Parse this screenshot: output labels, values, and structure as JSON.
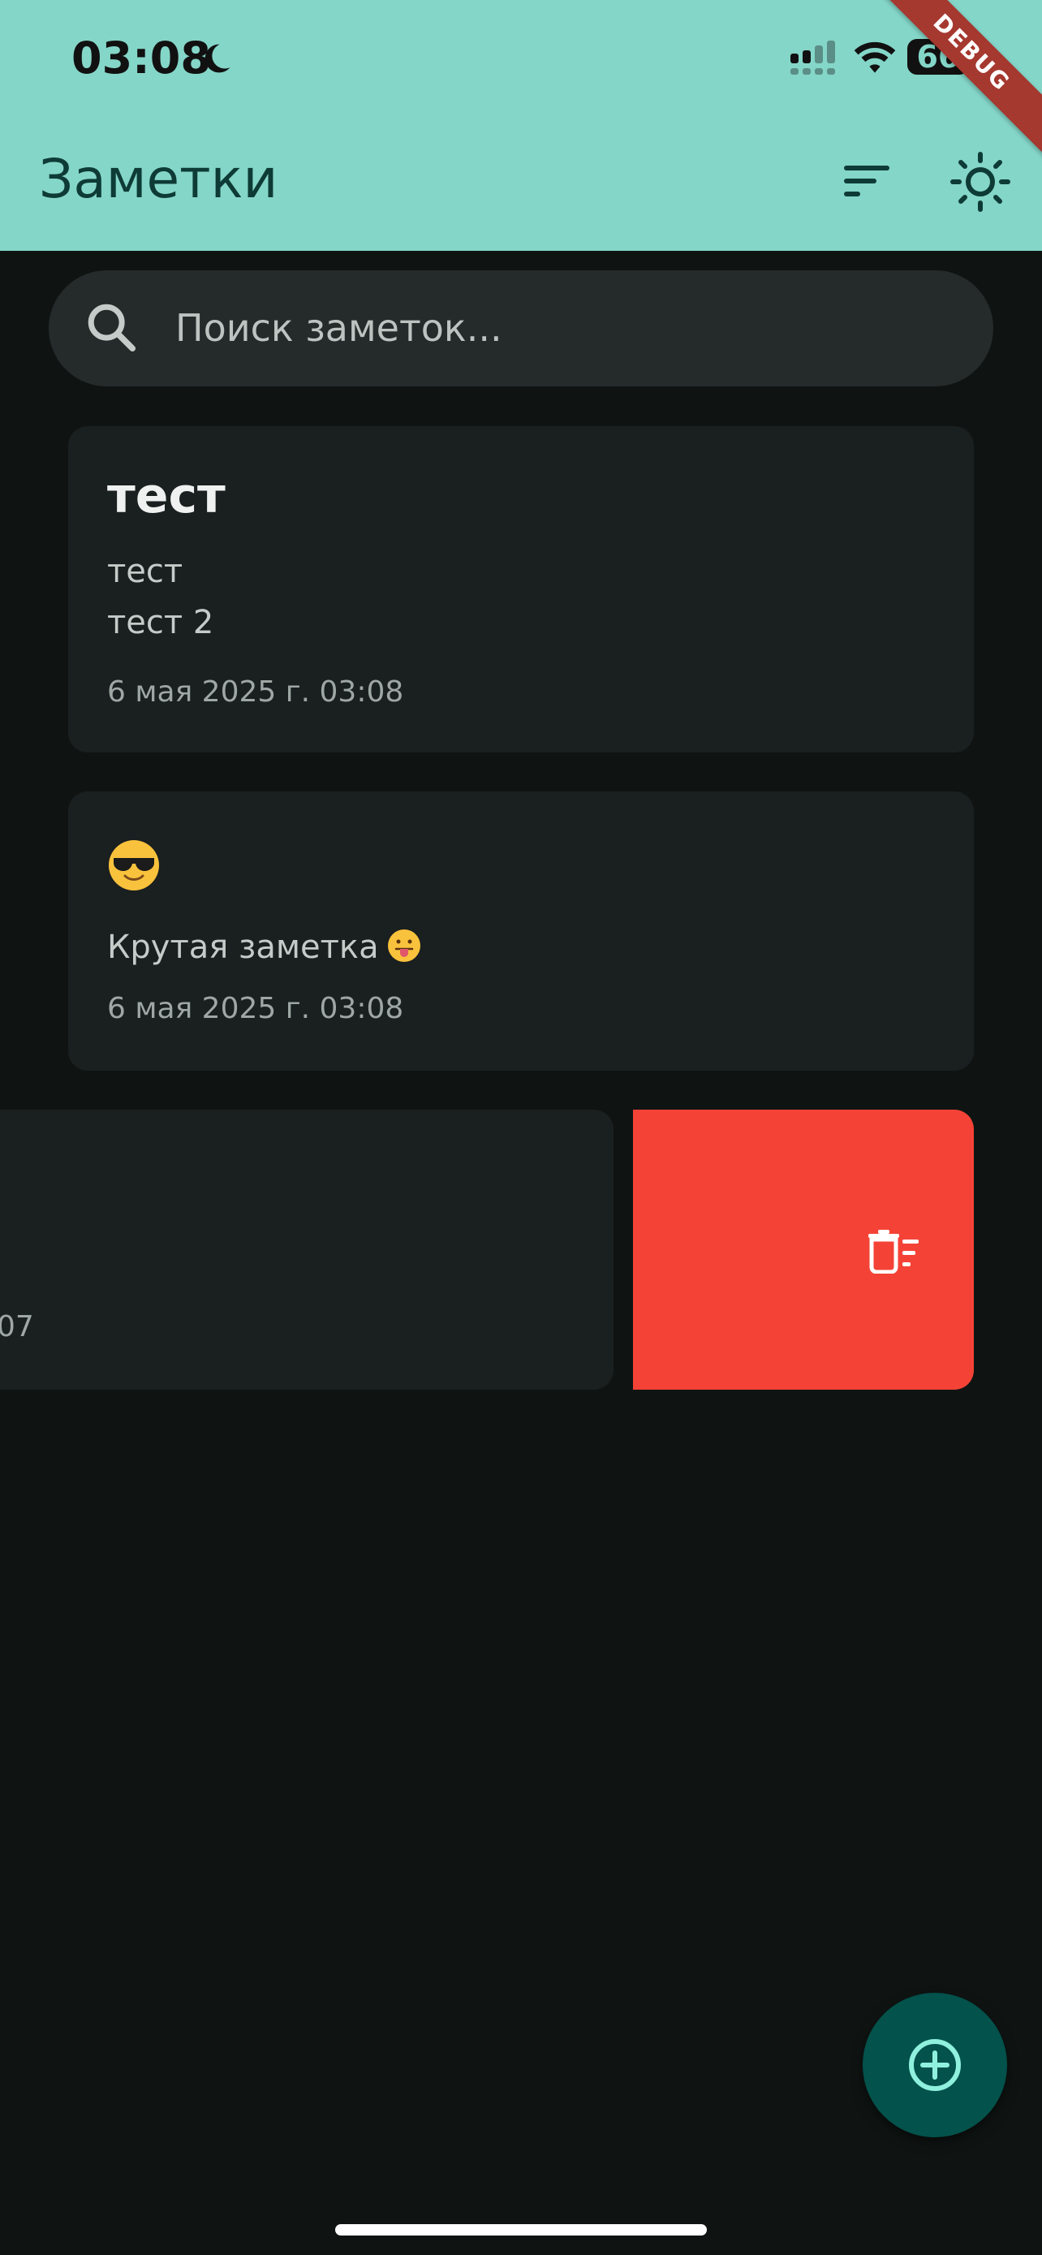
{
  "status_bar": {
    "time": "03:08",
    "battery": "66",
    "debug_label": "DEBUG"
  },
  "app_bar": {
    "title": "Заметки",
    "sort_icon": "sort-icon",
    "theme_icon": "sun-icon"
  },
  "search": {
    "placeholder": "Поиск заметок..."
  },
  "notes": [
    {
      "title": "тест",
      "lines": [
        "тест",
        "тест 2"
      ],
      "date": "6 мая 2025 г. 03:08"
    },
    {
      "title_emoji": "smiling-face-with-sunglasses",
      "text": "Крутая заметка",
      "text_emoji": "face-with-tongue",
      "date": "6 мая 2025 г. 03:08"
    },
    {
      "date_visible_fragment": "07",
      "swipe_action_icon": "delete-sweep-icon"
    }
  ],
  "fab": {
    "icon": "add-circle-icon"
  },
  "colors": {
    "app_bar": "#84d6c8",
    "background": "#0f1413",
    "card": "#1a1f1f",
    "delete": "#f44336",
    "fab": "#03524b"
  }
}
